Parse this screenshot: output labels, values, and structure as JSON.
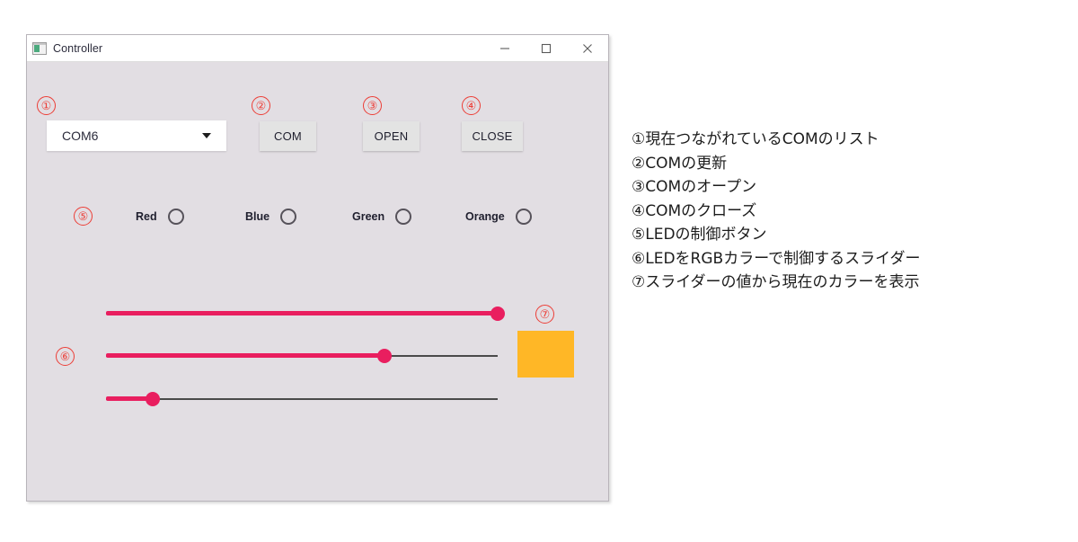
{
  "window": {
    "title": "Controller",
    "icon": "application-window-icon",
    "controls": {
      "minimize": "minimize-icon",
      "maximize": "maximize-icon",
      "close": "close-icon"
    }
  },
  "annotations": [
    {
      "id": "1",
      "label": "①"
    },
    {
      "id": "2",
      "label": "②"
    },
    {
      "id": "3",
      "label": "③"
    },
    {
      "id": "4",
      "label": "④"
    },
    {
      "id": "5",
      "label": "⑤"
    },
    {
      "id": "6",
      "label": "⑥"
    },
    {
      "id": "7",
      "label": "⑦"
    }
  ],
  "com_select": {
    "value": "COM6",
    "arrow_icon": "chevron-down-icon",
    "options": [
      "COM6"
    ]
  },
  "buttons": {
    "com": "COM",
    "open": "OPEN",
    "close": "CLOSE"
  },
  "radios": [
    {
      "label": "Red",
      "checked": false
    },
    {
      "label": "Blue",
      "checked": false
    },
    {
      "label": "Green",
      "checked": false
    },
    {
      "label": "Orange",
      "checked": false
    }
  ],
  "sliders": [
    {
      "name": "red-slider",
      "percent": 100
    },
    {
      "name": "green-slider",
      "percent": 71
    },
    {
      "name": "blue-slider",
      "percent": 12
    }
  ],
  "color_preview": {
    "color": "#ffb726"
  },
  "colors": {
    "slider_accent": "#e91e5f",
    "slider_track": "#4a4a4a",
    "annotation_red": "#ec3d36",
    "window_background": "#e2dee3",
    "titlebar_background": "#ffffff",
    "button_background": "#e3e3e3"
  },
  "legend": {
    "lines": [
      "①現在つながれているCOMのリスト",
      "②COMの更新",
      "③COMのオープン",
      "④COMのクローズ",
      "⑤LEDの制御ボタン",
      "⑥LEDをRGBカラーで制御するスライダー",
      "⑦スライダーの値から現在のカラーを表示"
    ]
  }
}
